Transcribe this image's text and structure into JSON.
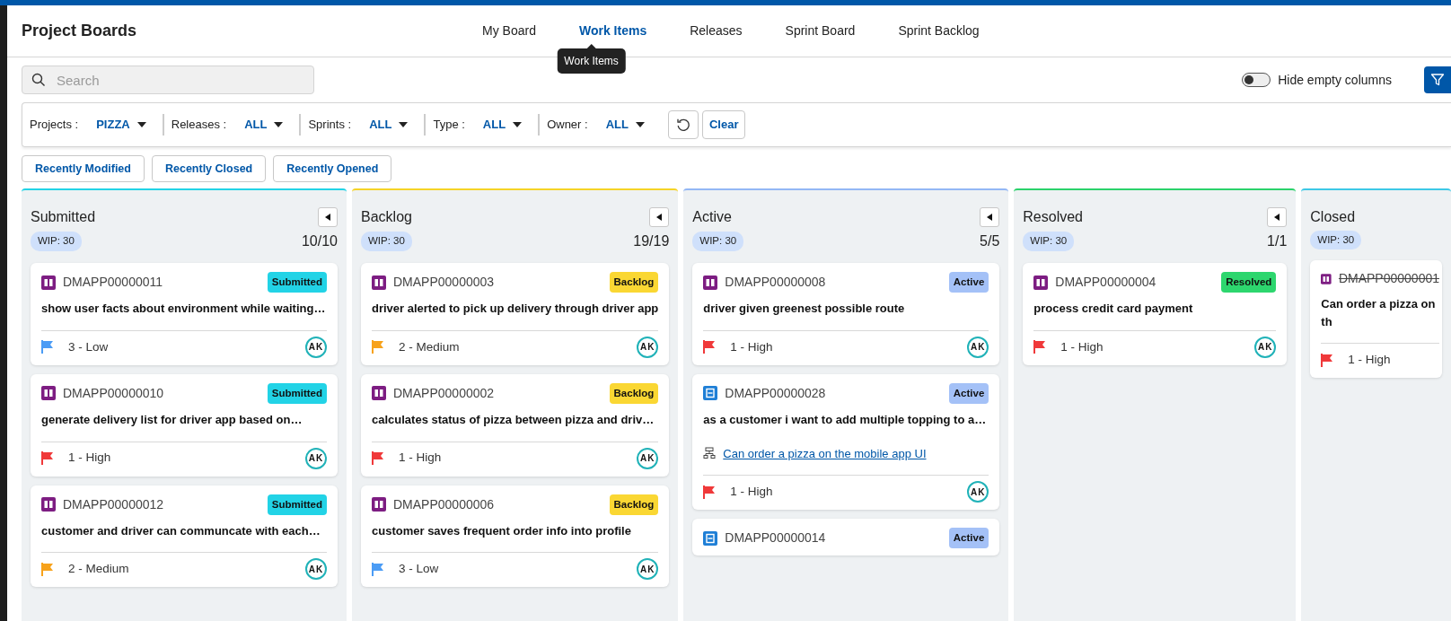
{
  "header": {
    "title": "Project Boards",
    "tabs": [
      {
        "label": "My Board",
        "selected": false
      },
      {
        "label": "Work Items",
        "selected": true
      },
      {
        "label": "Releases",
        "selected": false
      },
      {
        "label": "Sprint Board",
        "selected": false
      },
      {
        "label": "Sprint Backlog",
        "selected": false
      }
    ],
    "tooltip": "Work Items"
  },
  "search": {
    "placeholder": "Search"
  },
  "hide_empty_columns": {
    "label": "Hide empty columns",
    "on": false
  },
  "filters": [
    {
      "label": "Projects :",
      "value": "PIZZA"
    },
    {
      "label": "Releases :",
      "value": "ALL"
    },
    {
      "label": "Sprints :",
      "value": "ALL"
    },
    {
      "label": "Type :",
      "value": "ALL"
    },
    {
      "label": "Owner :",
      "value": "ALL"
    }
  ],
  "clear_button": "Clear",
  "quick_filters": [
    "Recently Modified",
    "Recently Closed",
    "Recently Opened"
  ],
  "columns": [
    {
      "name": "Submitted",
      "color": "#22d3e6",
      "wip": "WIP: 30",
      "count": "10/10",
      "cards": [
        {
          "kind": "feature",
          "id": "DMAPP00000011",
          "status": {
            "label": "Submitted",
            "color": "#22d3e6"
          },
          "title": "show user facts about environment while waiting…",
          "priority": {
            "label": "3 - Low",
            "color": "#4b9cf5"
          },
          "assignee": "AK",
          "closed": false
        },
        {
          "kind": "feature",
          "id": "DMAPP00000010",
          "status": {
            "label": "Submitted",
            "color": "#22d3e6"
          },
          "title": "generate delivery list for driver app based on…",
          "priority": {
            "label": "1 - High",
            "color": "#f0393a"
          },
          "assignee": "AK",
          "closed": false
        },
        {
          "kind": "feature",
          "id": "DMAPP00000012",
          "status": {
            "label": "Submitted",
            "color": "#22d3e6"
          },
          "title": "customer and driver can communcate with each…",
          "priority": {
            "label": "2 - Medium",
            "color": "#f7a21b"
          },
          "assignee": "AK",
          "closed": false
        }
      ]
    },
    {
      "name": "Backlog",
      "color": "#f5d327",
      "wip": "WIP: 30",
      "count": "19/19",
      "cards": [
        {
          "kind": "feature",
          "id": "DMAPP00000003",
          "status": {
            "label": "Backlog",
            "color": "#fad733"
          },
          "title": "driver alerted to pick up delivery through driver app",
          "priority": {
            "label": "2 - Medium",
            "color": "#f7a21b"
          },
          "assignee": "AK",
          "closed": false
        },
        {
          "kind": "feature",
          "id": "DMAPP00000002",
          "status": {
            "label": "Backlog",
            "color": "#fad733"
          },
          "title": "calculates status of pizza between pizza and driv…",
          "priority": {
            "label": "1 - High",
            "color": "#f0393a"
          },
          "assignee": "AK",
          "closed": false
        },
        {
          "kind": "feature",
          "id": "DMAPP00000006",
          "status": {
            "label": "Backlog",
            "color": "#fad733"
          },
          "title": "customer saves frequent order info into profile",
          "priority": {
            "label": "3 - Low",
            "color": "#4b9cf5"
          },
          "assignee": "AK",
          "closed": false
        }
      ]
    },
    {
      "name": "Active",
      "color": "#93b7f5",
      "wip": "WIP: 30",
      "count": "5/5",
      "cards": [
        {
          "kind": "feature",
          "id": "DMAPP00000008",
          "status": {
            "label": "Active",
            "color": "#a4c1f7"
          },
          "title": "driver given greenest possible route",
          "priority": {
            "label": "1 - High",
            "color": "#f0393a"
          },
          "assignee": "AK",
          "closed": false
        },
        {
          "kind": "story",
          "id": "DMAPP00000028",
          "status": {
            "label": "Active",
            "color": "#a4c1f7"
          },
          "title": "as a customer i want to add multiple topping to a…",
          "parent_link": "Can order a pizza on the mobile app UI",
          "priority": {
            "label": "1 - High",
            "color": "#f0393a"
          },
          "assignee": "AK",
          "closed": false
        },
        {
          "kind": "story",
          "id": "DMAPP00000014",
          "status": {
            "label": "Active",
            "color": "#a4c1f7"
          },
          "closed": false
        }
      ]
    },
    {
      "name": "Resolved",
      "color": "#2bd26b",
      "wip": "WIP: 30",
      "count": "1/1",
      "cards": [
        {
          "kind": "feature",
          "id": "DMAPP00000004",
          "status": {
            "label": "Resolved",
            "color": "#2dd66e"
          },
          "title": "process credit card payment",
          "priority": {
            "label": "1 - High",
            "color": "#f0393a"
          },
          "assignee": "AK",
          "closed": false
        }
      ]
    },
    {
      "name": "Closed",
      "color": "#3dc8e6",
      "wip": "WIP: 30",
      "cards": [
        {
          "kind": "feature",
          "id": "DMAPP00000001",
          "title": "Can order a pizza on th",
          "priority": {
            "label": "1 - High",
            "color": "#f0393a"
          },
          "closed": true
        }
      ]
    }
  ]
}
